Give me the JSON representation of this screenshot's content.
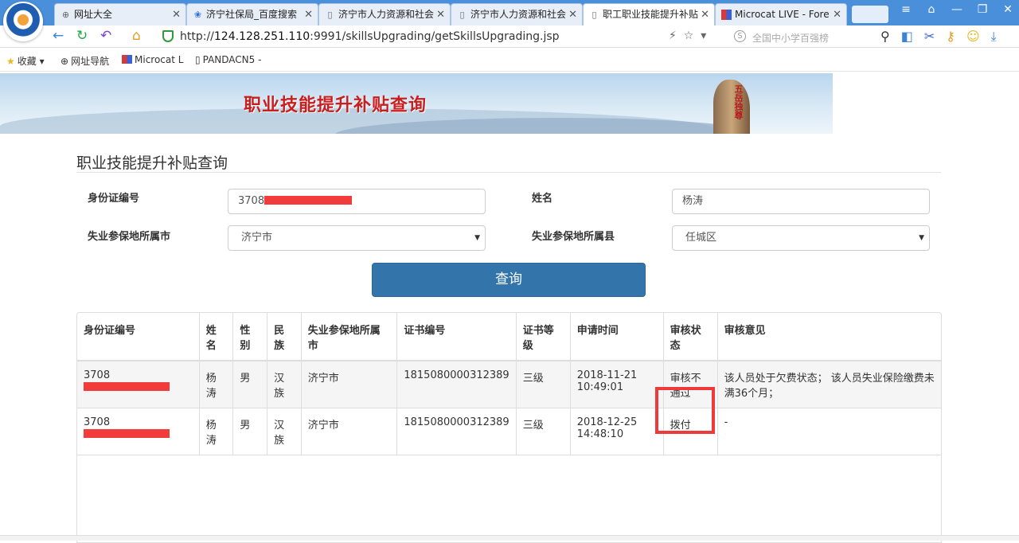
{
  "browser": {
    "tabs": [
      {
        "label": "网址大全",
        "icon": "globe-icon",
        "active": false
      },
      {
        "label": "济宁社保局_百度搜索",
        "icon": "baidu-paw-icon",
        "active": false
      },
      {
        "label": "济宁市人力资源和社会",
        "icon": "page-icon",
        "active": false
      },
      {
        "label": "济宁市人力资源和社会",
        "icon": "page-icon",
        "active": false
      },
      {
        "label": "职工职业技能提升补贴",
        "icon": "page-icon",
        "active": true
      },
      {
        "label": "Microcat LIVE - Fore",
        "icon": "microcat-icon",
        "active": false
      }
    ],
    "url_prefix": "http://",
    "url_host": "124.128.251.110",
    "url_rest": ":9991/skillsUpgrading/getSkillsUpgrading.jsp",
    "search_hint": "全国中小学百强榜",
    "bookmarks": [
      {
        "label": "收藏",
        "icon": "star-icon"
      },
      {
        "label": "网址导航",
        "icon": "globe-icon"
      },
      {
        "label": "Microcat L",
        "icon": "microcat-icon"
      },
      {
        "label": "PANDACN5 -",
        "icon": "page-icon"
      }
    ]
  },
  "banner": {
    "title": "职业技能提升补贴查询",
    "seal_text": "五岳独尊"
  },
  "form": {
    "page_title": "职业技能提升补贴查询",
    "id_label": "身份证编号",
    "id_value_prefix": "3708",
    "name_label": "姓名",
    "name_value": "杨涛",
    "city_label": "失业参保地所属市",
    "city_value": "济宁市",
    "county_label": "失业参保地所属县",
    "county_value": "任城区",
    "query_button": "查询"
  },
  "table": {
    "headers": [
      "身份证编号",
      "姓名",
      "性别",
      "民族",
      "失业参保地所属市",
      "证书编号",
      "证书等级",
      "申请时间",
      "审核状态",
      "审核意见"
    ],
    "rows": [
      {
        "id_prefix": "3708",
        "name": "杨涛",
        "gender": "男",
        "ethnicity": "汉族",
        "city": "济宁市",
        "cert_no": "1815080000312389",
        "cert_level": "三级",
        "apply_date": "2018-11-21",
        "apply_time": "10:49:01",
        "status": "审核不通过",
        "opinion": "该人员处于欠费状态； 该人员失业保险缴费未满36个月；"
      },
      {
        "id_prefix": "3708",
        "name": "杨涛",
        "gender": "男",
        "ethnicity": "汉族",
        "city": "济宁市",
        "cert_no": "1815080000312389",
        "cert_level": "三级",
        "apply_date": "2018-12-25",
        "apply_time": "14:48:10",
        "status": "拨付",
        "opinion": "-"
      }
    ]
  },
  "colors": {
    "tabbar": "#4a8fd9",
    "query_button": "#3374ab",
    "redaction": "#f23c3c",
    "highlight": "#ee3a3a",
    "banner_title": "#c81e1e"
  }
}
